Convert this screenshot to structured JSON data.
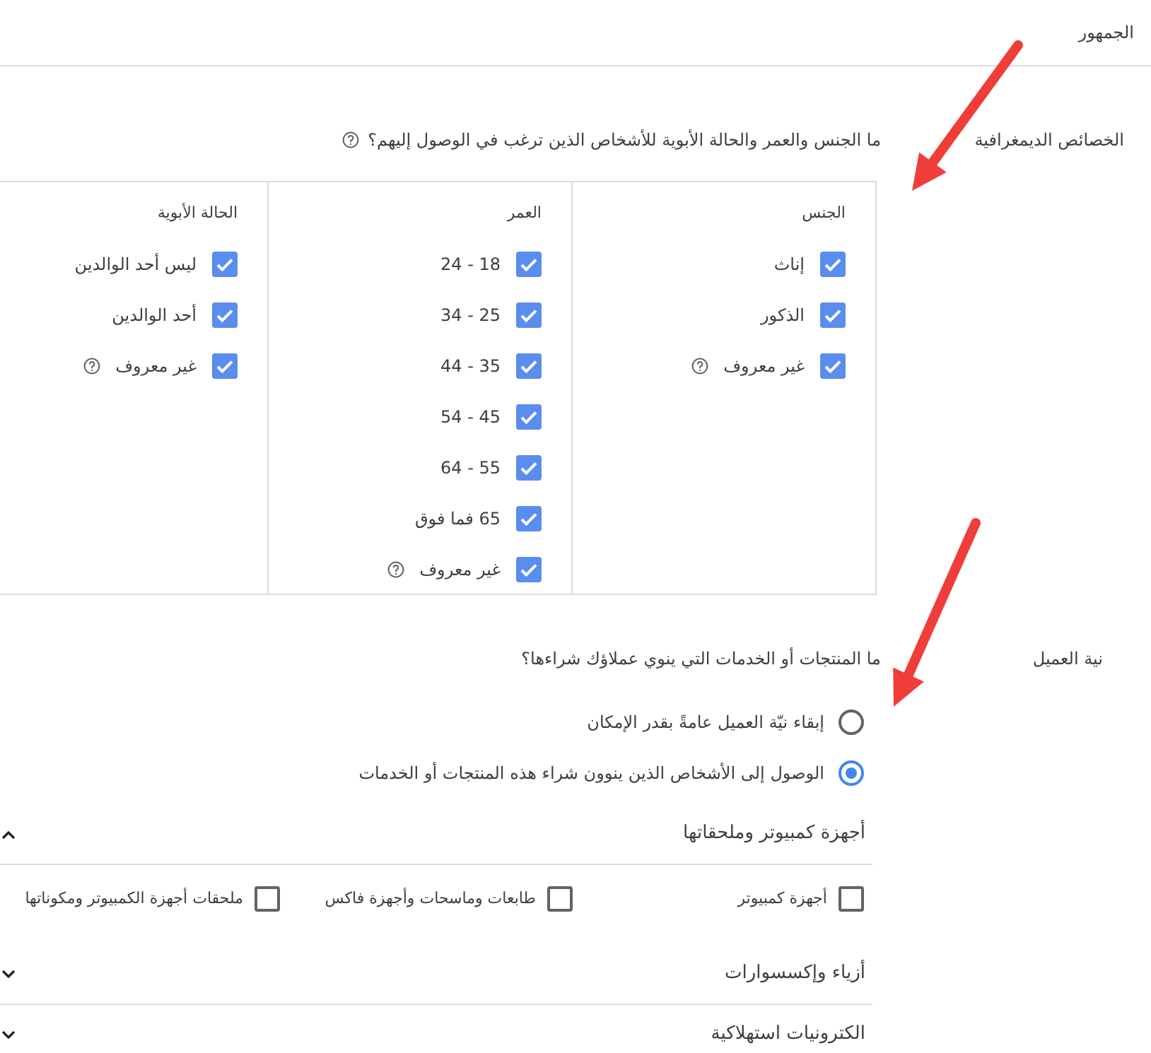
{
  "header": {
    "title": "الجمهور"
  },
  "demographics": {
    "label": "الخصائص الديمغرافية",
    "question": "ما الجنس والعمر والحالة الأبوية للأشخاص الذين ترغب في الوصول إليهم؟",
    "groups": [
      {
        "title": "الجنس",
        "options": [
          {
            "label": "إناث",
            "checked": true,
            "help": false
          },
          {
            "label": "الذكور",
            "checked": true,
            "help": false
          },
          {
            "label": "غير معروف",
            "checked": true,
            "help": true
          }
        ]
      },
      {
        "title": "العمر",
        "options": [
          {
            "label": "18 - 24",
            "checked": true,
            "help": false
          },
          {
            "label": "25 - 34",
            "checked": true,
            "help": false
          },
          {
            "label": "35 - 44",
            "checked": true,
            "help": false
          },
          {
            "label": "45 - 54",
            "checked": true,
            "help": false
          },
          {
            "label": "55 - 64",
            "checked": true,
            "help": false
          },
          {
            "label": "65 فما فوق",
            "checked": true,
            "help": false
          },
          {
            "label": "غير معروف",
            "checked": true,
            "help": true
          }
        ]
      },
      {
        "title": "الحالة الأبوية",
        "options": [
          {
            "label": "ليس أحد الوالدين",
            "checked": true,
            "help": false
          },
          {
            "label": "أحد الوالدين",
            "checked": true,
            "help": false
          },
          {
            "label": "غير معروف",
            "checked": true,
            "help": true
          }
        ]
      }
    ]
  },
  "intent": {
    "label": "نية العميل",
    "question": "ما المنتجات أو الخدمات التي ينوي عملاؤك شراءها؟",
    "options": [
      {
        "label": "إبقاء نيّة العميل عامةً بقدر الإمكان",
        "selected": false
      },
      {
        "label": "الوصول إلى الأشخاص الذين ينوون شراء هذه المنتجات أو الخدمات",
        "selected": true
      }
    ]
  },
  "categories": [
    {
      "title": "أجهزة كمبيوتر وملحقاتها",
      "expanded": true,
      "items": [
        {
          "label": "أجهزة كمبيوتر",
          "checked": false
        },
        {
          "label": "طابعات وماسحات وأجهزة فاكس",
          "checked": false
        },
        {
          "label": "ملحقات أجهزة الكمبيوتر ومكوناتها",
          "checked": false
        }
      ]
    },
    {
      "title": "أزياء وإكسسوارات",
      "expanded": false
    },
    {
      "title": "الكترونيات استهلاكية",
      "expanded": false
    }
  ]
}
